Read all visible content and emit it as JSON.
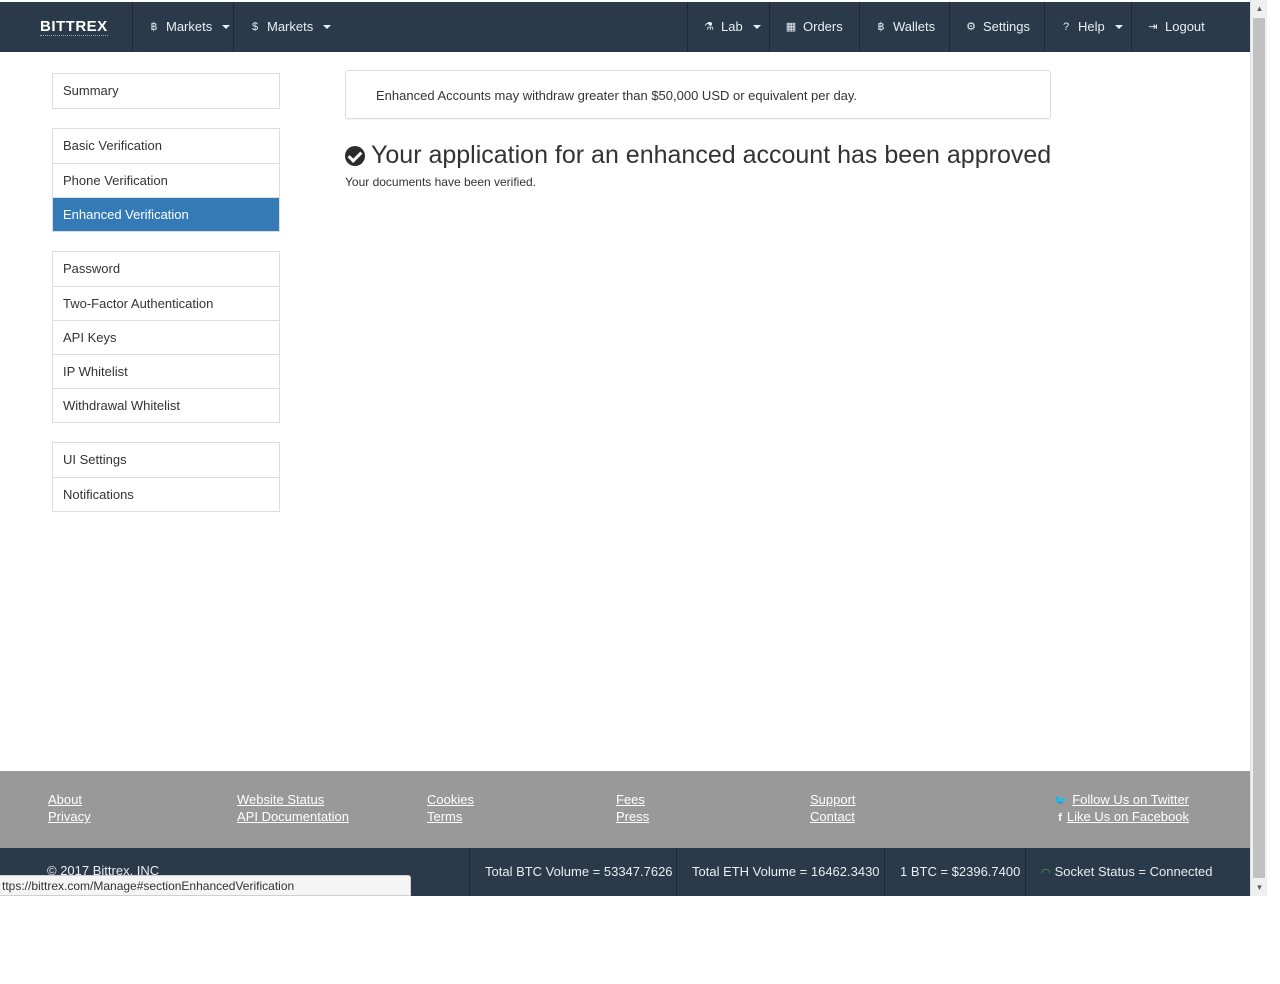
{
  "navbar": {
    "brand": "BITTREX",
    "items": [
      {
        "icon": "bitcoin-icon",
        "glyph": "฿",
        "label": "Markets",
        "dropdown": true
      },
      {
        "icon": "dollar-icon",
        "glyph": "$",
        "label": "Markets",
        "dropdown": true
      },
      {
        "icon": "flask-icon",
        "glyph": "⚗",
        "label": "Lab",
        "dropdown": true
      },
      {
        "icon": "calendar-icon",
        "glyph": "▦",
        "label": "Orders",
        "dropdown": false
      },
      {
        "icon": "bitcoin-icon",
        "glyph": "฿",
        "label": "Wallets",
        "dropdown": false
      },
      {
        "icon": "gear-icon",
        "glyph": "⚙",
        "label": "Settings",
        "dropdown": false
      },
      {
        "icon": "question-icon",
        "glyph": "?",
        "label": "Help",
        "dropdown": true
      },
      {
        "icon": "logout-icon",
        "glyph": "⇥",
        "label": "Logout",
        "dropdown": false
      }
    ]
  },
  "sidebar": {
    "groups": [
      [
        "Summary"
      ],
      [
        "Basic Verification",
        "Phone Verification",
        "Enhanced Verification"
      ],
      [
        "Password",
        "Two-Factor Authentication",
        "API Keys",
        "IP Whitelist",
        "Withdrawal Whitelist"
      ],
      [
        "UI Settings",
        "Notifications"
      ]
    ],
    "active": "Enhanced Verification"
  },
  "main": {
    "info": "Enhanced Accounts may withdraw greater than $50,000 USD or equivalent per day.",
    "title": "Your application for an enhanced account has been approved",
    "subtitle": "Your documents have been verified."
  },
  "footer": {
    "links": [
      "About",
      "Privacy",
      "Website Status",
      "API Documentation",
      "Cookies",
      "Terms",
      "Fees",
      "Press",
      "Support",
      "Contact"
    ],
    "twitter": "Follow Us on Twitter",
    "facebook": "Like Us on Facebook"
  },
  "status": {
    "copyright": "© 2017 Bittrex, INC",
    "btc_volume": "Total BTC Volume = 53347.7626",
    "eth_volume": "Total ETH Volume = 16462.3430",
    "btc_price": "1 BTC = $2396.7400",
    "socket": "Socket Status = Connected"
  },
  "url_tooltip": "ttps://bittrex.com/Manage#sectionEnhancedVerification"
}
